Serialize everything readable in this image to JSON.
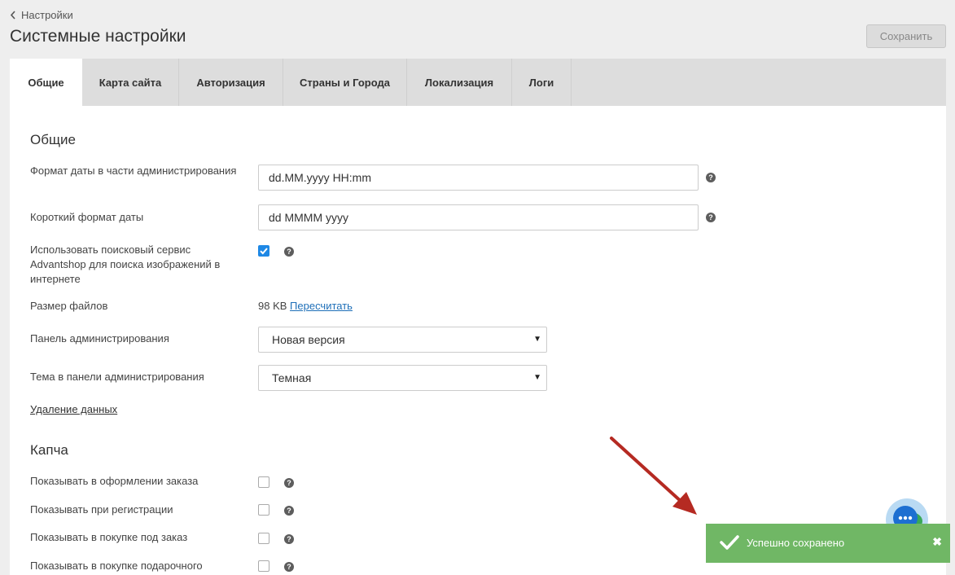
{
  "breadcrumb": {
    "label": "Настройки"
  },
  "page": {
    "title": "Системные настройки",
    "save_label": "Сохранить"
  },
  "tabs": [
    {
      "label": "Общие",
      "active": true
    },
    {
      "label": "Карта сайта"
    },
    {
      "label": "Авторизация"
    },
    {
      "label": "Страны и Города"
    },
    {
      "label": "Локализация"
    },
    {
      "label": "Логи"
    }
  ],
  "general": {
    "title": "Общие",
    "date_format_label": "Формат даты в части администрирования",
    "date_format_value": "dd.MM.yyyy HH:mm",
    "short_date_label": "Короткий формат даты",
    "short_date_value": "dd MMMM yyyy",
    "image_search_label": "Использовать поисковый сервис Advantshop для поиска изображений в интернете",
    "image_search_checked": true,
    "file_size_label": "Размер файлов",
    "file_size_value": "98 KB",
    "recalc_link": "Пересчитать",
    "admin_panel_label": "Панель администрирования",
    "admin_panel_value": "Новая версия",
    "admin_theme_label": "Тема в панели администрирования",
    "admin_theme_value": "Темная",
    "delete_data_link": "Удаление данных"
  },
  "captcha": {
    "title": "Капча",
    "items": [
      {
        "label": "Показывать в оформлении заказа",
        "checked": false
      },
      {
        "label": "Показывать при регистрации",
        "checked": false
      },
      {
        "label": "Показывать в покупке под заказ",
        "checked": false
      },
      {
        "label": "Показывать в покупке подарочного",
        "checked": false
      }
    ]
  },
  "toast": {
    "message": "Успешно сохранено",
    "close": "✖"
  },
  "help_glyph": "?",
  "colors": {
    "accent": "#1e88e5",
    "toast": "#70b765",
    "arrow": "#b52a22",
    "tab_bar": "#dddddd"
  }
}
